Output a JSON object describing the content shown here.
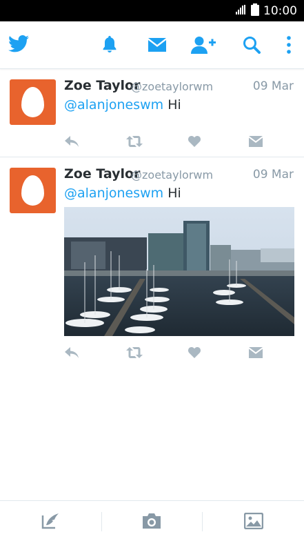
{
  "status_bar": {
    "time": "10:00",
    "signal_icon": "signal-icon",
    "battery_icon": "battery-icon"
  },
  "colors": {
    "brand": "#1da1f2",
    "text": "#292f33",
    "muted": "#8899a6",
    "avatar": "#e8632d",
    "action_icon": "#aab8c2"
  },
  "app_bar": {
    "icons": [
      "twitter-bird-icon",
      "notifications-bell-icon",
      "messages-envelope-icon",
      "add-user-icon",
      "search-icon",
      "more-vertical-icon"
    ]
  },
  "tweets": [
    {
      "name": "Zoe Taylor",
      "handle": "@zoetaylorwm",
      "date": "09 Mar",
      "mention": "@alanjoneswm",
      "text": " Hi",
      "has_media": false
    },
    {
      "name": "Zoe Taylor",
      "handle": "@zoetaylorwm",
      "date": "09 Mar",
      "mention": "@alanjoneswm",
      "text": " Hi",
      "has_media": true
    }
  ],
  "tweet_actions": [
    "reply-icon",
    "retweet-icon",
    "like-heart-icon",
    "direct-message-icon"
  ],
  "bottom_bar": {
    "icons": [
      "compose-icon",
      "camera-icon",
      "gallery-icon"
    ]
  }
}
